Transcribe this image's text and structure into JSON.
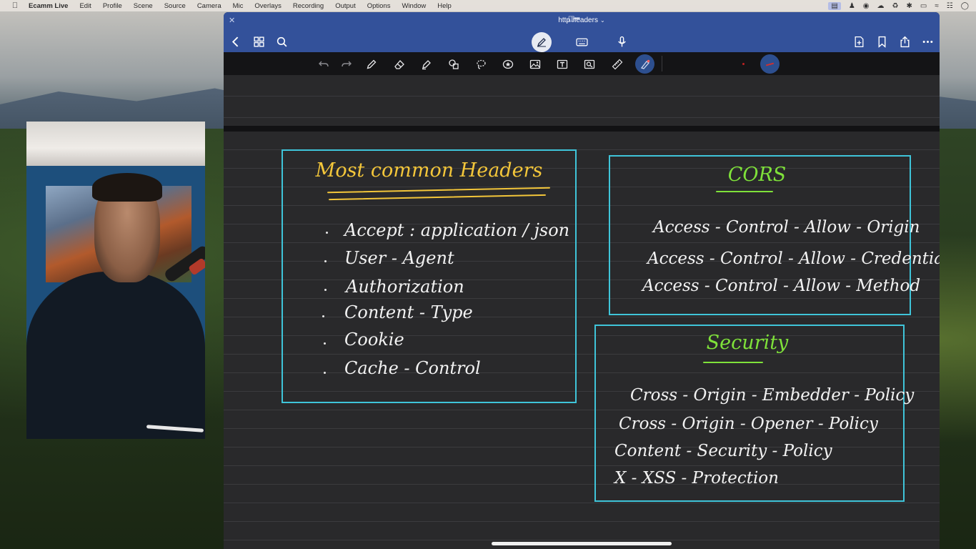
{
  "menubar": {
    "app_name": "Ecamm Live",
    "items": [
      "Edit",
      "Profile",
      "Scene",
      "Source",
      "Camera",
      "Mic",
      "Overlays",
      "Recording",
      "Output",
      "Options",
      "Window",
      "Help"
    ]
  },
  "document": {
    "title": "http headers"
  },
  "notes": {
    "common": {
      "title": "Most common Headers",
      "items": [
        "Accept  :  application / json",
        "User - Agent",
        "Authorization",
        "Content - Type",
        "Cookie",
        "Cache - Control"
      ]
    },
    "cors": {
      "title": "CORS",
      "items": [
        "Access - Control - Allow - Origin",
        "Access - Control - Allow - Credentials",
        "Access - Control - Allow - Method"
      ]
    },
    "security": {
      "title": "Security",
      "items": [
        "Cross - Origin - Embedder - Policy",
        "Cross - Origin - Opener - Policy",
        "Content - Security - Policy",
        "X - XSS - Protection"
      ]
    }
  },
  "colors": {
    "box_border": "#3fc4d9",
    "title_common": "#f3c63a",
    "title_green": "#7fe23a",
    "toolbar": "#33519a"
  }
}
